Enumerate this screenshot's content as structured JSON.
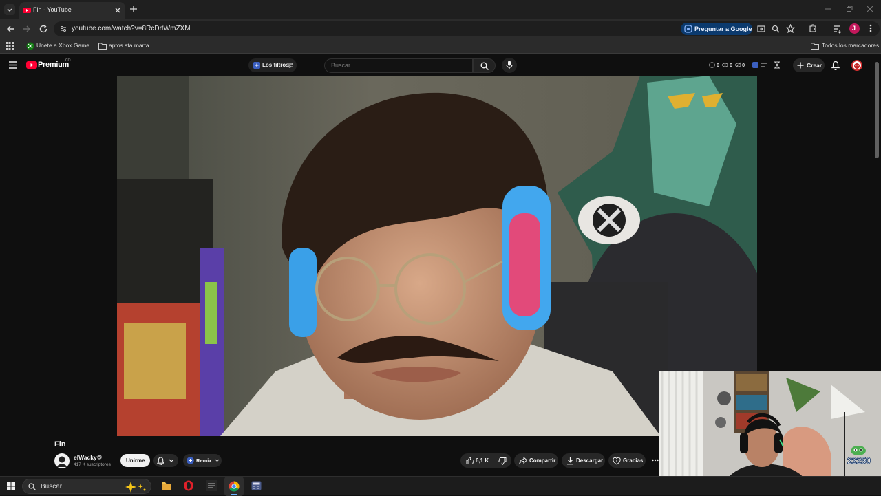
{
  "browser": {
    "tab_title": "Fin - YouTube",
    "url": "youtube.com/watch?v=8RcDrtWmZXM",
    "ask_google": "Preguntar a Google",
    "bookmarks": [
      "Únete a Xbox Game...",
      "aptos sta marta"
    ],
    "all_bookmarks": "Todos los marcadores",
    "profile_initial": "J"
  },
  "youtube": {
    "brand": "Premium",
    "brand_sup": "CO",
    "filters_label": "Los filtros",
    "search_placeholder": "Buscar",
    "counters": [
      "0",
      "0",
      "0"
    ],
    "create_label": "Crear"
  },
  "video": {
    "title": "Fin",
    "channel": "elWacky",
    "subscribers": "417 K suscriptores",
    "join_label": "Unirme",
    "remix_label": "Remix",
    "likes": "6,1 K",
    "share_label": "Compartir",
    "download_label": "Descargar",
    "thanks_label": "Gracias"
  },
  "overlay": {
    "count": "22250"
  },
  "taskbar": {
    "search_placeholder": "Buscar"
  },
  "colors": {
    "accent_blue": "#1a73e8",
    "yt_red": "#ff0033",
    "profile": "#c2185b"
  }
}
